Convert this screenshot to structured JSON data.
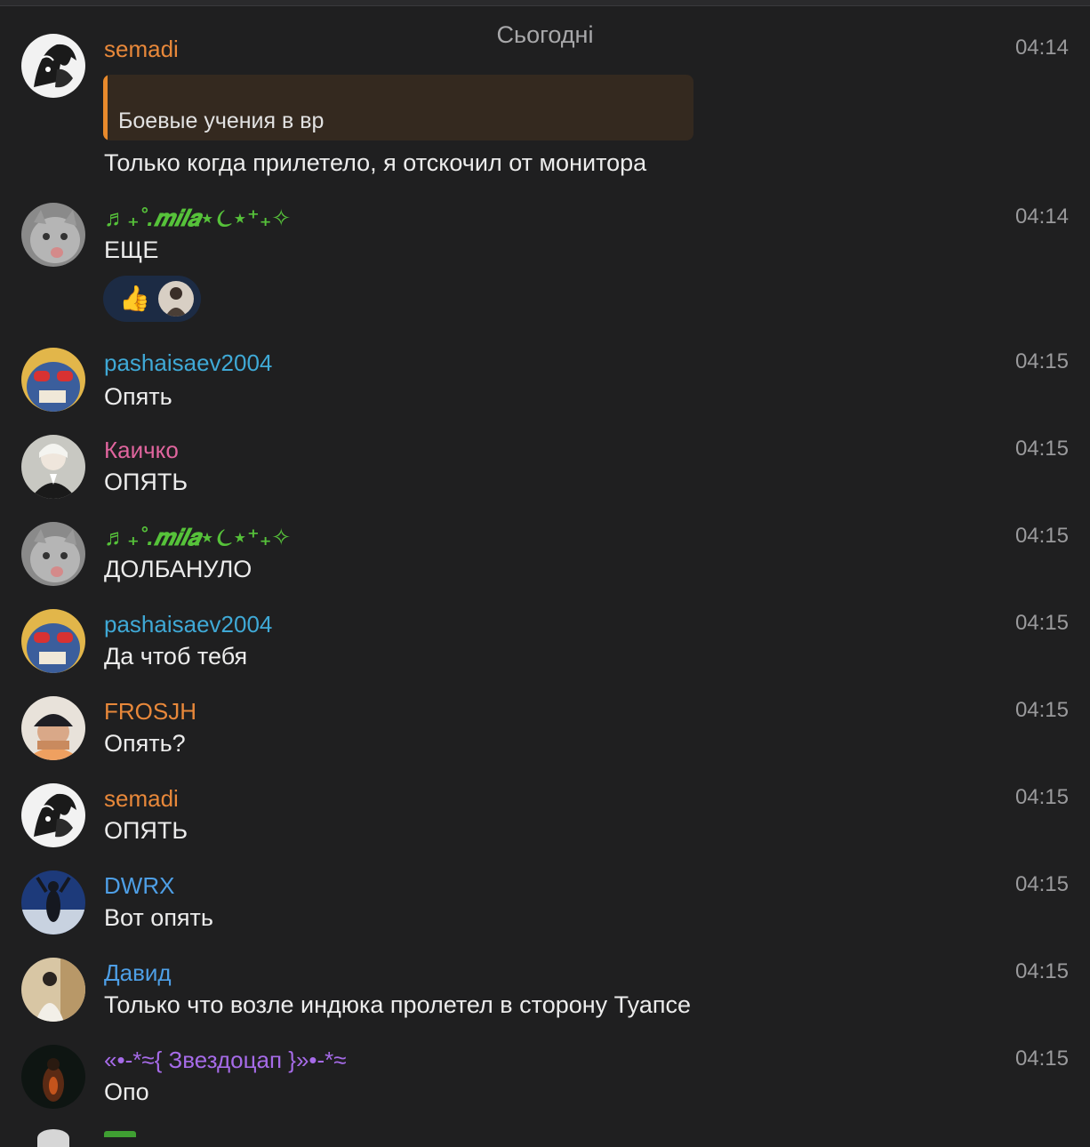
{
  "date_header": "Сьогодні",
  "colors": {
    "background": "#1f1f20",
    "quote_accent": "#e88a2c",
    "reaction_bg": "#1c2b44"
  },
  "messages": [
    {
      "author": "semadi",
      "time": "04:14",
      "reply": "Боевые учения в вр",
      "text": "Только когда прилетело, я отскочил от монитора"
    },
    {
      "author": "♬₊˚.𝒎𝒊𝒍𝒂⋆⏾⋆⁺₊✧",
      "time": "04:14",
      "text": "ЕЩЕ",
      "reaction": {
        "emoji": "👍",
        "icon": "reactor-avatar"
      }
    },
    {
      "author": "pashaisaev2004",
      "time": "04:15",
      "text": "Опять"
    },
    {
      "author": "Каичко",
      "time": "04:15",
      "text": "ОПЯТЬ"
    },
    {
      "author": "♬₊˚.𝒎𝒊𝒍𝒂⋆⏾⋆⁺₊✧",
      "time": "04:15",
      "text": "ДОЛБАНУЛО"
    },
    {
      "author": "pashaisaev2004",
      "time": "04:15",
      "text": "Да чтоб тебя"
    },
    {
      "author": "FROSJH",
      "time": "04:15",
      "text": "Опять?"
    },
    {
      "author": "semadi",
      "time": "04:15",
      "text": "ОПЯТЬ"
    },
    {
      "author": "DWRX",
      "time": "04:15",
      "text": "Вот опять"
    },
    {
      "author": "Давид",
      "time": "04:15",
      "text": "Только что возле индюка пролетел в сторону  Туапсе"
    },
    {
      "author": "«•-*≈{ Звездоцап }»•-*≈",
      "time": "04:15",
      "text": "Опо"
    }
  ]
}
